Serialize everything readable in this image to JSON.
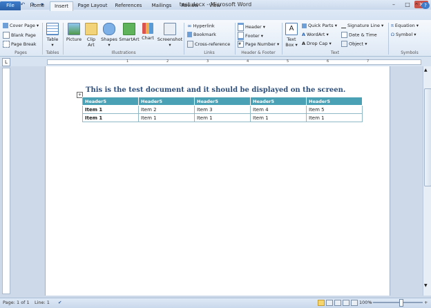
{
  "window": {
    "title": "test.docx - Microsoft Word"
  },
  "quick_access": [
    "save-icon",
    "undo-icon",
    "redo-icon",
    "customize-icon"
  ],
  "window_buttons": {
    "minimize": "–",
    "maximize": "□",
    "close": "✕"
  },
  "tabs": [
    {
      "label": "File"
    },
    {
      "label": "Home"
    },
    {
      "label": "Insert"
    },
    {
      "label": "Page Layout"
    },
    {
      "label": "References"
    },
    {
      "label": "Mailings"
    },
    {
      "label": "Review"
    },
    {
      "label": "View"
    }
  ],
  "ribbon": {
    "pages": {
      "label": "Pages",
      "items": [
        "Cover Page",
        "Blank Page",
        "Page Break"
      ]
    },
    "tables": {
      "label": "Tables",
      "table": "Table"
    },
    "illustrations": {
      "label": "Illustrations",
      "picture": "Picture",
      "clipart": "Clip Art",
      "shapes": "Shapes",
      "smartart": "SmartArt",
      "chart": "Chart",
      "screenshot": "Screenshot"
    },
    "links": {
      "label": "Links",
      "items": [
        "Hyperlink",
        "Bookmark",
        "Cross-reference"
      ]
    },
    "header_footer": {
      "label": "Header & Footer",
      "items": [
        "Header",
        "Footer",
        "Page Number"
      ]
    },
    "text": {
      "label": "Text",
      "textbox": "Text Box",
      "col1": [
        "Quick Parts",
        "WordArt",
        "Drop Cap"
      ],
      "col2": [
        "Signature Line",
        "Date & Time",
        "Object"
      ]
    },
    "symbols": {
      "label": "Symbols",
      "items": [
        "Equation",
        "Symbol"
      ]
    }
  },
  "ruler": {
    "numbers": [
      "1",
      "2",
      "3",
      "4",
      "5",
      "6",
      "7"
    ]
  },
  "document": {
    "title": "This is the test document and it should be displayed on the screen.",
    "table": {
      "header": [
        "Header5",
        "Header5",
        "Header5",
        "Header5",
        "Header5"
      ],
      "rows": [
        [
          "Item 1",
          "Item 2",
          "Item 3",
          "Item 4",
          "Item 5"
        ],
        [
          "Item 1",
          "Item 1",
          "Item 1",
          "Item 1",
          "Item 1"
        ]
      ]
    }
  },
  "status": {
    "page": "Page: 1 of 1",
    "line": "Line: 1",
    "zoom": "100%",
    "zoom_minus": "−",
    "zoom_plus": "+"
  }
}
